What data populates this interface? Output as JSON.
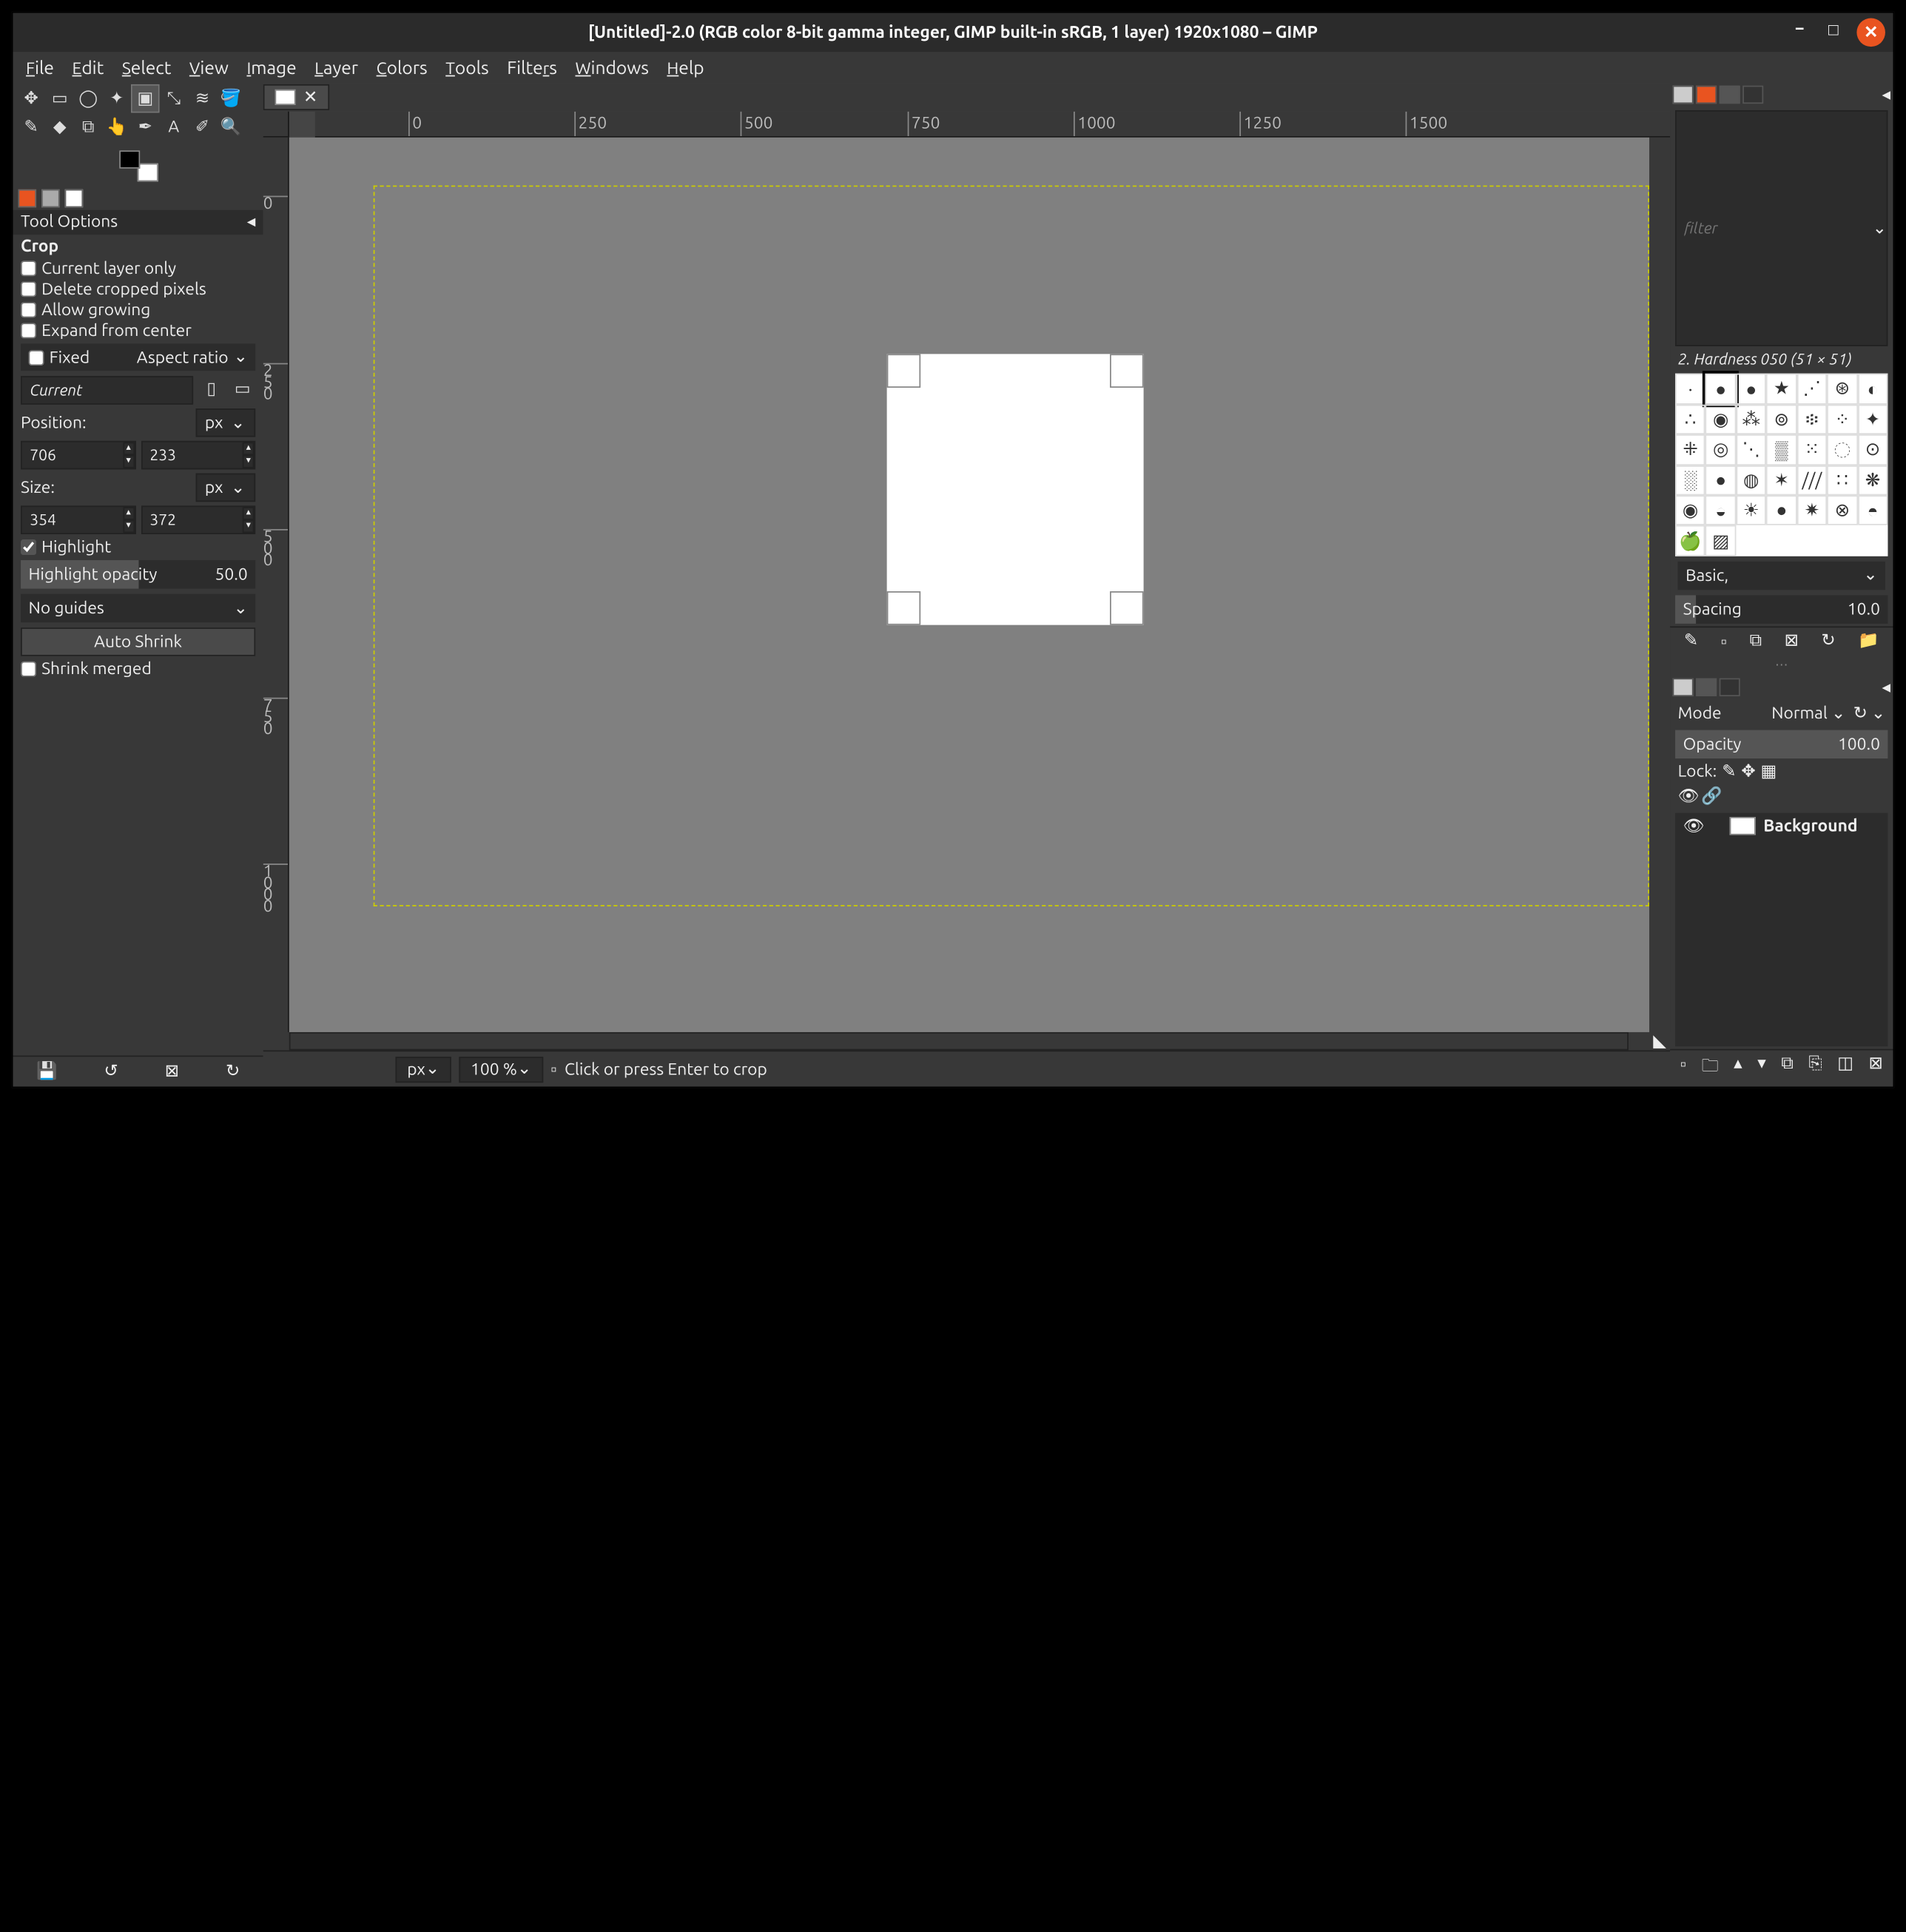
{
  "title": "[Untitled]-2.0 (RGB color 8-bit gamma integer, GIMP built-in sRGB, 1 layer) 1920x1080 – GIMP",
  "menu": [
    "File",
    "Edit",
    "Select",
    "View",
    "Image",
    "Layer",
    "Colors",
    "Tools",
    "Filters",
    "Windows",
    "Help"
  ],
  "toolOptions": {
    "toolName": "Crop",
    "currentLayerOnly": "Current layer only",
    "deleteCropped": "Delete cropped pixels",
    "allowGrowing": "Allow growing",
    "expandFromCenter": "Expand from center",
    "fixedLabel": "Fixed",
    "fixedMode": "Aspect ratio",
    "currentLabel": "Current",
    "positionLabel": "Position:",
    "positionUnit": "px",
    "posX": "706",
    "posY": "233",
    "sizeLabel": "Size:",
    "sizeUnit": "px",
    "sizeW": "354",
    "sizeH": "372",
    "highlightLabel": "Highlight",
    "highlightChecked": true,
    "highlightOpacityLabel": "Highlight opacity",
    "highlightOpacityValue": "50.0",
    "guidesMode": "No guides",
    "autoShrink": "Auto Shrink",
    "shrinkMerged": "Shrink merged"
  },
  "status": {
    "unit": "px",
    "zoom": "100 %",
    "hint": "Click or press Enter to crop"
  },
  "brushes": {
    "filterPlaceholder": "filter",
    "name": "2. Hardness 050 (51 × 51)",
    "preset": "Basic,",
    "spacingLabel": "Spacing",
    "spacingValue": "10.0"
  },
  "layers": {
    "modeLabel": "Mode",
    "modeValue": "Normal",
    "opacityLabel": "Opacity",
    "opacityValue": "100.0",
    "lockLabel": "Lock:",
    "layerName": "Background"
  },
  "ruler_h": [
    {
      "px": 72,
      "label": "0"
    },
    {
      "px": 200,
      "label": "250"
    },
    {
      "px": 328,
      "label": "500"
    },
    {
      "px": 457,
      "label": "750"
    },
    {
      "px": 585,
      "label": "1000"
    },
    {
      "px": 713,
      "label": "1250"
    },
    {
      "px": 841,
      "label": "1500"
    }
  ],
  "ruler_v": [
    {
      "px": 45,
      "label": "0"
    },
    {
      "px": 174,
      "label": "250"
    },
    {
      "px": 302,
      "label": "500"
    },
    {
      "px": 432,
      "label": "750"
    },
    {
      "px": 560,
      "label": "1000"
    }
  ]
}
